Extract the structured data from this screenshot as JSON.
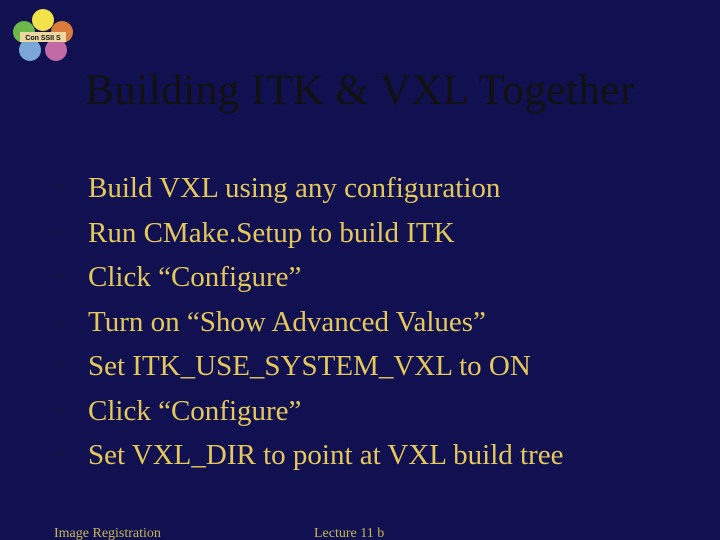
{
  "logo_label": "Con SSII S",
  "title": "Building ITK & VXL Together",
  "bullets": [
    "Build VXL using any configuration",
    "Run CMake.Setup to build ITK",
    "Click “Configure”",
    "Turn on “Show Advanced Values”",
    "Set ITK_USE_SYSTEM_VXL to ON",
    "Click “Configure”",
    "Set VXL_DIR to point at VXL build tree"
  ],
  "footer": {
    "left": "Image Registration",
    "mid": "Lecture 11 b"
  }
}
